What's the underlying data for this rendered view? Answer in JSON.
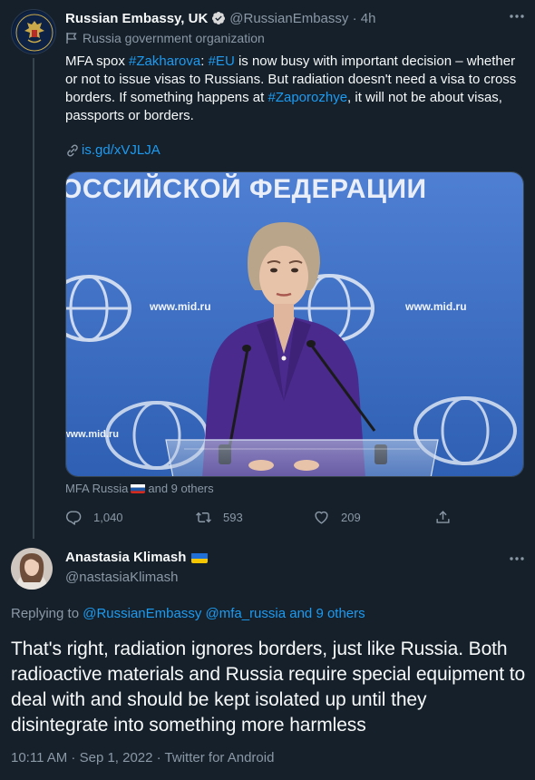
{
  "tweet1": {
    "display_name": "Russian Embassy, UK",
    "handle": "@RussianEmbassy",
    "time": "4h",
    "separator": "·",
    "org_label": "Russia government organization",
    "text_parts": [
      {
        "type": "text",
        "value": "MFA spox "
      },
      {
        "type": "link",
        "value": "#Zakharova"
      },
      {
        "type": "text",
        "value": ": "
      },
      {
        "type": "link",
        "value": "#EU"
      },
      {
        "type": "text",
        "value": " is now busy with important decision – whether or not to issue visas to Russians. But radiation doesn't need a visa to cross borders. If something happens at "
      },
      {
        "type": "link",
        "value": "#Zaporozhye"
      },
      {
        "type": "text",
        "value": ", it will not be about visas, passports or borders."
      }
    ],
    "short_link": "is.gd/xVJLJA",
    "media_caption_prefix": "MFA Russia",
    "media_caption_suffix": "and 9 others",
    "media_banner_text": "ОССИЙСКОЙ ФЕДЕРАЦИИ",
    "media_website_text": "www.mid.ru",
    "actions": {
      "replies": "1,040",
      "retweets": "593",
      "likes": "209"
    },
    "icons": [
      "verified-badge-icon",
      "more-icon",
      "flag-icon",
      "link-icon",
      "reply-icon",
      "retweet-icon",
      "like-icon",
      "share-icon"
    ]
  },
  "tweet2": {
    "display_name": "Anastasia Klimash",
    "handle": "@nastasiaKlimash",
    "replying_prefix": "Replying to",
    "replying_mentions": "@RussianEmbassy @mfa_russia and 9 others",
    "text": "That's right, radiation ignores borders, just like Russia. Both radioactive materials and Russia require special equipment to deal with and should be kept isolated up until they disintegrate into something more harmless",
    "meta": "10:11 AM · Sep 1, 2022 · Twitter for Android"
  },
  "colors": {
    "background": "#15202b",
    "text": "#f7f9f9",
    "muted": "#8b98a5",
    "link": "#1d9bf0",
    "divider": "#38444d"
  }
}
